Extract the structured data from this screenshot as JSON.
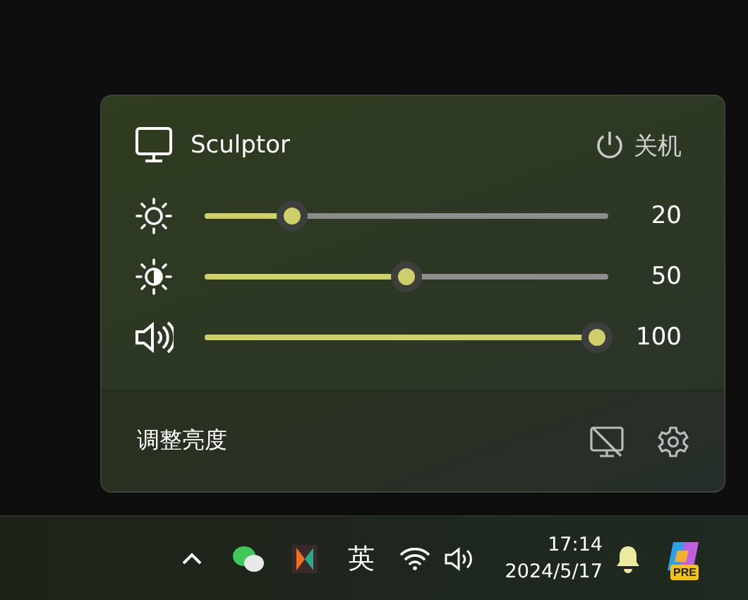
{
  "panel": {
    "monitor_name": "Sculptor",
    "power_label": "关机",
    "sliders": [
      {
        "kind": "brightness",
        "level": 0.2,
        "reading": "20"
      },
      {
        "kind": "contrast",
        "level": 0.5,
        "reading": "50"
      },
      {
        "kind": "volume",
        "level": 1.0,
        "reading": "100"
      }
    ],
    "footer_label": "调整亮度"
  },
  "taskbar": {
    "input_method": "英",
    "time": "17:14",
    "date": "2024/5/17",
    "copilot_badge": "PRE"
  }
}
